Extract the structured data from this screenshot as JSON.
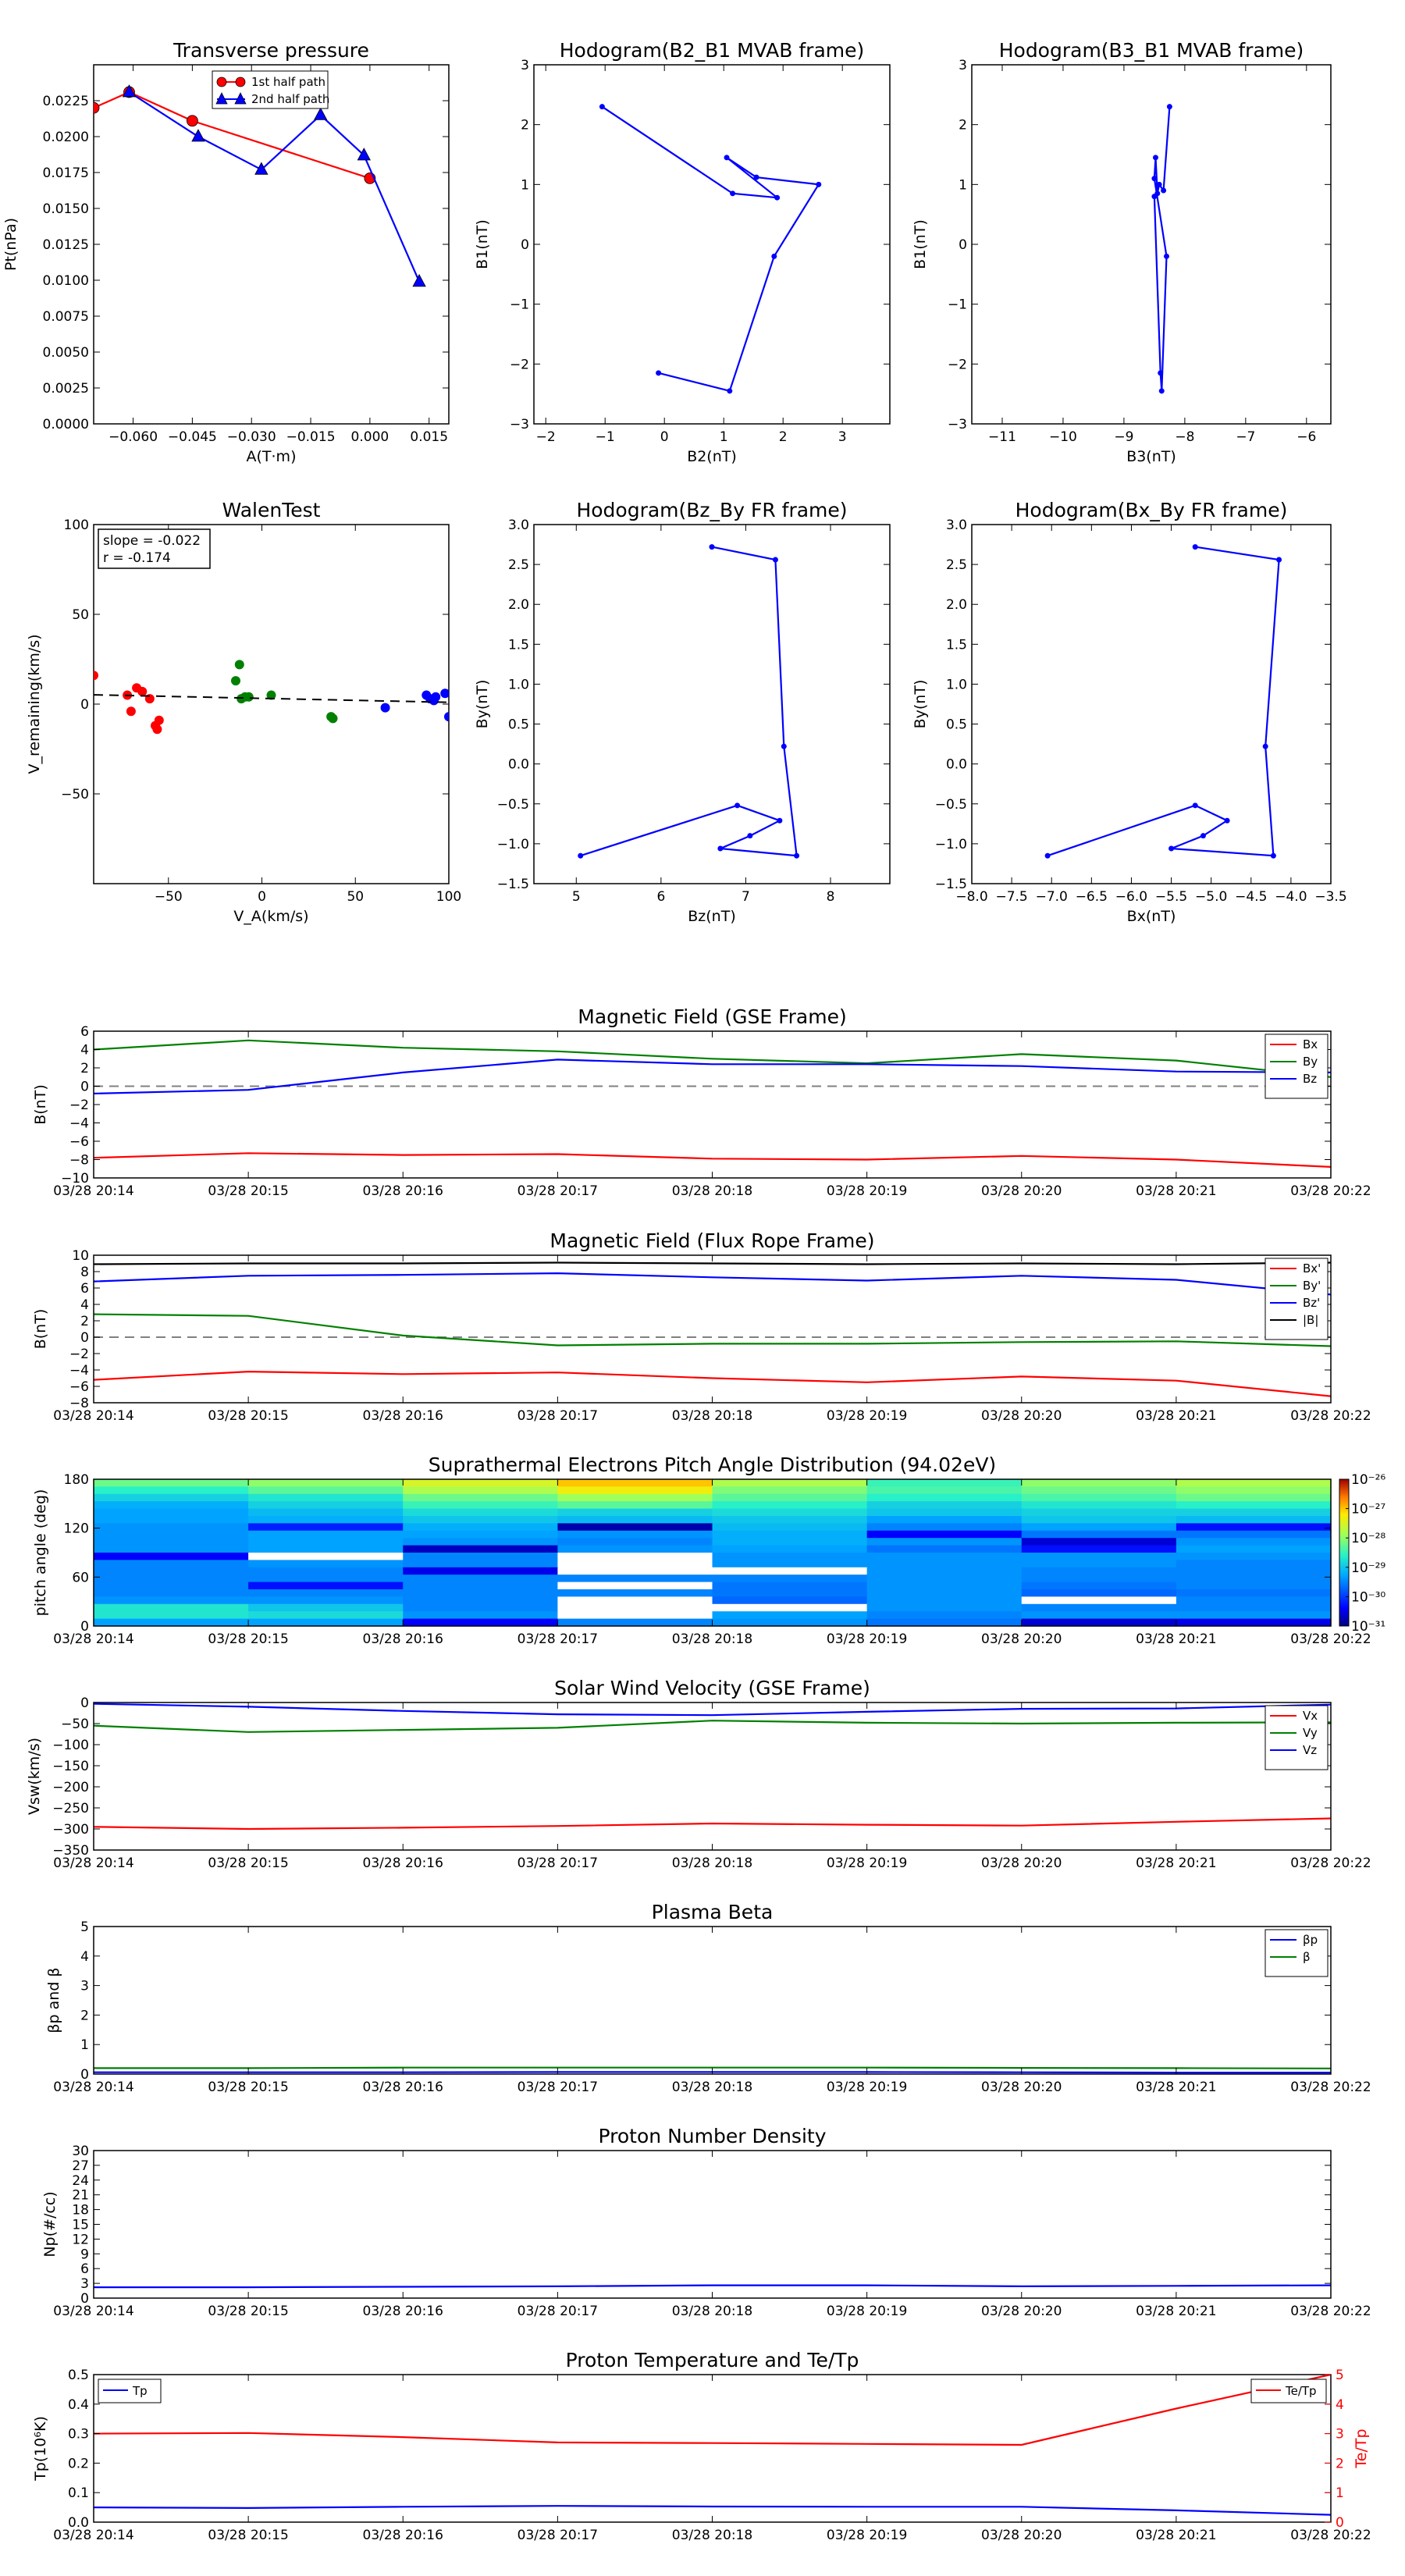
{
  "colors": {
    "red": "#ff0000",
    "green": "#008000",
    "blue": "#0000ff",
    "black": "#000000"
  },
  "time_ticks": [
    "03/28 20:14",
    "03/28 20:15",
    "03/28 20:16",
    "03/28 20:17",
    "03/28 20:18",
    "03/28 20:19",
    "03/28 20:20",
    "03/28 20:21",
    "03/28 20:22"
  ],
  "chart_data": [
    {
      "id": "transverse_pressure",
      "type": "line",
      "title": "Transverse pressure",
      "xlabel": "A(T·m)",
      "ylabel": "Pt(nPa)",
      "xlim": [
        -0.07,
        0.02
      ],
      "ylim": [
        0,
        0.025
      ],
      "xticks": [
        -0.06,
        -0.045,
        -0.03,
        -0.015,
        0.0,
        0.015
      ],
      "xtick_labels": [
        "−0.060",
        "−0.045",
        "−0.030",
        "−0.015",
        "0.000",
        "0.015"
      ],
      "yticks": [
        0,
        0.0025,
        0.005,
        0.0075,
        0.01,
        0.0125,
        0.015,
        0.0175,
        0.02,
        0.0225
      ],
      "ytick_labels": [
        "0.0000",
        "0.0025",
        "0.0050",
        "0.0075",
        "0.0100",
        "0.0125",
        "0.0150",
        "0.0175",
        "0.0200",
        "0.0225"
      ],
      "legend": [
        "1st half path",
        "2nd half path"
      ],
      "series": [
        {
          "name": "1st half path",
          "color": "#ff0000",
          "marker": "circle",
          "x": [
            -0.07,
            -0.061,
            -0.045,
            0.0
          ],
          "y": [
            0.022,
            0.0231,
            0.0211,
            0.0171
          ]
        },
        {
          "name": "2nd half path",
          "color": "#0000ff",
          "marker": "triangle",
          "x": [
            -0.061,
            -0.0435,
            -0.0275,
            -0.0125,
            -0.0015,
            0.0125
          ],
          "y": [
            0.0231,
            0.02,
            0.0177,
            0.0215,
            0.0187,
            0.0099
          ]
        }
      ]
    },
    {
      "id": "hodo_b2b1",
      "type": "line",
      "title": "Hodogram(B2_B1 MVAB frame)",
      "xlabel": "B2(nT)",
      "ylabel": "B1(nT)",
      "xlim": [
        -2.2,
        3.8
      ],
      "ylim": [
        -3,
        3
      ],
      "xticks": [
        -2,
        -1,
        0,
        1,
        2,
        3
      ],
      "xtick_labels": [
        "−2",
        "−1",
        "0",
        "1",
        "2",
        "3"
      ],
      "yticks": [
        -3,
        -2,
        -1,
        0,
        1,
        2,
        3
      ],
      "ytick_labels": [
        "−3",
        "−2",
        "−1",
        "0",
        "1",
        "2",
        "3"
      ],
      "series": [
        {
          "color": "#0000ff",
          "x": [
            -1.05,
            1.15,
            1.9,
            1.05,
            1.55,
            2.6,
            1.85,
            1.1,
            -0.1
          ],
          "y": [
            2.3,
            0.85,
            0.78,
            1.45,
            1.12,
            1.0,
            -0.2,
            -2.45,
            -2.15
          ]
        }
      ]
    },
    {
      "id": "hodo_b3b1",
      "type": "line",
      "title": "Hodogram(B3_B1 MVAB frame)",
      "xlabel": "B3(nT)",
      "ylabel": "B1(nT)",
      "xlim": [
        -11.5,
        -5.6
      ],
      "ylim": [
        -3,
        3
      ],
      "xticks": [
        -11,
        -10,
        -9,
        -8,
        -7,
        -6
      ],
      "xtick_labels": [
        "−11",
        "−10",
        "−9",
        "−8",
        "−7",
        "−6"
      ],
      "yticks": [
        -3,
        -2,
        -1,
        0,
        1,
        2,
        3
      ],
      "ytick_labels": [
        "−3",
        "−2",
        "−1",
        "0",
        "1",
        "2",
        "3"
      ],
      "series": [
        {
          "color": "#0000ff",
          "x": [
            -8.25,
            -8.35,
            -8.42,
            -8.45,
            -8.48,
            -8.5,
            -8.3,
            -8.38,
            -8.4,
            -8.5
          ],
          "y": [
            2.3,
            0.9,
            1.0,
            0.85,
            1.45,
            1.1,
            -0.2,
            -2.45,
            -2.15,
            0.8
          ]
        }
      ]
    },
    {
      "id": "walen",
      "type": "scatter",
      "title": "WalenTest",
      "xlabel": "V_A(km/s)",
      "ylabel": "V_remaining(km/s)",
      "xlim": [
        -90,
        100
      ],
      "ylim": [
        -100,
        100
      ],
      "xticks": [
        -50,
        0,
        50,
        100
      ],
      "xtick_labels": [
        "−50",
        "0",
        "50",
        "100"
      ],
      "yticks": [
        -50,
        0,
        50,
        100
      ],
      "ytick_labels": [
        "−50",
        "0",
        "50",
        "100"
      ],
      "annotation": {
        "line1": "slope = -0.022",
        "line2": "r = -0.174"
      },
      "fit": {
        "slope": -0.022,
        "intercept": 3.2
      },
      "series": [
        {
          "color": "#ff0000",
          "x": [
            -90,
            -72,
            -70,
            -67,
            -64,
            -60,
            -57,
            -56,
            -55
          ],
          "y": [
            16,
            5,
            -4,
            9,
            7,
            3,
            -12,
            -14,
            -9
          ]
        },
        {
          "color": "#008000",
          "x": [
            -14,
            -12,
            -11,
            -9,
            -7,
            5,
            37,
            38
          ],
          "y": [
            13,
            22,
            3,
            4,
            4,
            5,
            -7,
            -8
          ]
        },
        {
          "color": "#0000ff",
          "x": [
            66,
            88,
            90,
            92,
            93,
            98,
            100
          ],
          "y": [
            -2,
            5,
            3,
            2,
            4,
            6,
            -7
          ]
        }
      ]
    },
    {
      "id": "hodo_bzby",
      "type": "line",
      "title": "Hodogram(Bz_By FR frame)",
      "xlabel": "Bz(nT)",
      "ylabel": "By(nT)",
      "xlim": [
        4.5,
        8.7
      ],
      "ylim": [
        -1.5,
        3.0
      ],
      "xticks": [
        5,
        6,
        7,
        8
      ],
      "xtick_labels": [
        "5",
        "6",
        "7",
        "8"
      ],
      "yticks": [
        -1.5,
        -1.0,
        -0.5,
        0.0,
        0.5,
        1.0,
        1.5,
        2.0,
        2.5,
        3.0
      ],
      "ytick_labels": [
        "−1.5",
        "−1.0",
        "−0.5",
        "0.0",
        "0.5",
        "1.0",
        "1.5",
        "2.0",
        "2.5",
        "3.0"
      ],
      "series": [
        {
          "color": "#0000ff",
          "x": [
            6.6,
            7.35,
            7.45,
            7.6,
            6.7,
            7.05,
            7.4,
            6.9,
            5.05
          ],
          "y": [
            2.72,
            2.56,
            0.22,
            -1.15,
            -1.06,
            -0.9,
            -0.71,
            -0.52,
            -1.15
          ]
        }
      ]
    },
    {
      "id": "hodo_bxby",
      "type": "line",
      "title": "Hodogram(Bx_By FR frame)",
      "xlabel": "Bx(nT)",
      "ylabel": "By(nT)",
      "xlim": [
        -8.0,
        -3.5
      ],
      "ylim": [
        -1.5,
        3.0
      ],
      "xticks": [
        -8.0,
        -7.5,
        -7.0,
        -6.5,
        -6.0,
        -5.5,
        -5.0,
        -4.5,
        -4.0,
        -3.5
      ],
      "xtick_labels": [
        "−8.0",
        "−7.5",
        "−7.0",
        "−6.5",
        "−6.0",
        "−5.5",
        "−5.0",
        "−4.5",
        "−4.0",
        "−3.5"
      ],
      "yticks": [
        -1.5,
        -1.0,
        -0.5,
        0.0,
        0.5,
        1.0,
        1.5,
        2.0,
        2.5,
        3.0
      ],
      "ytick_labels": [
        "−1.5",
        "−1.0",
        "−0.5",
        "0.0",
        "0.5",
        "1.0",
        "1.5",
        "2.0",
        "2.5",
        "3.0"
      ],
      "series": [
        {
          "color": "#0000ff",
          "x": [
            -5.2,
            -4.15,
            -4.32,
            -4.22,
            -5.5,
            -5.1,
            -4.8,
            -5.2,
            -7.05
          ],
          "y": [
            2.72,
            2.56,
            0.22,
            -1.15,
            -1.06,
            -0.9,
            -0.71,
            -0.52,
            -1.15
          ]
        }
      ]
    },
    {
      "id": "mag_gse",
      "type": "line",
      "title": "Magnetic Field (GSE Frame)",
      "ylabel": "B(nT)",
      "ylim": [
        -10,
        6
      ],
      "yticks": [
        -10,
        -8,
        -6,
        -4,
        -2,
        0,
        2,
        4,
        6
      ],
      "ytick_labels": [
        "−10",
        "−8",
        "−6",
        "−4",
        "−2",
        "0",
        "2",
        "4",
        "6"
      ],
      "zero_line": true,
      "legend_pos": "right",
      "series": [
        {
          "name": "Bx",
          "color": "#ff0000",
          "y": [
            -7.8,
            -7.3,
            -7.5,
            -7.4,
            -7.9,
            -8.0,
            -7.6,
            -8.0,
            -8.8
          ]
        },
        {
          "name": "By",
          "color": "#008000",
          "y": [
            4.0,
            5.0,
            4.2,
            3.8,
            3.0,
            2.5,
            3.5,
            2.8,
            1.0
          ]
        },
        {
          "name": "Bz",
          "color": "#0000ff",
          "y": [
            -0.8,
            -0.4,
            1.5,
            2.9,
            2.4,
            2.4,
            2.2,
            1.6,
            1.5
          ]
        }
      ]
    },
    {
      "id": "mag_fr",
      "type": "line",
      "title": "Magnetic Field (Flux Rope Frame)",
      "ylabel": "B(nT)",
      "ylim": [
        -8,
        10
      ],
      "yticks": [
        -8,
        -6,
        -4,
        -2,
        0,
        2,
        4,
        6,
        8,
        10
      ],
      "ytick_labels": [
        "−8",
        "−6",
        "−4",
        "−2",
        "0",
        "2",
        "4",
        "6",
        "8",
        "10"
      ],
      "zero_line": true,
      "legend_pos": "right",
      "series": [
        {
          "name": "Bx'",
          "color": "#ff0000",
          "y": [
            -5.2,
            -4.2,
            -4.5,
            -4.3,
            -5.0,
            -5.5,
            -4.8,
            -5.3,
            -7.2
          ]
        },
        {
          "name": "By'",
          "color": "#008000",
          "y": [
            2.8,
            2.6,
            0.2,
            -1.0,
            -0.8,
            -0.8,
            -0.6,
            -0.5,
            -1.1
          ]
        },
        {
          "name": "Bz'",
          "color": "#0000ff",
          "y": [
            6.8,
            7.5,
            7.6,
            7.8,
            7.3,
            6.9,
            7.5,
            7.0,
            5.2
          ]
        },
        {
          "name": "|B|",
          "color": "#000000",
          "y": [
            8.9,
            9.0,
            9.0,
            9.1,
            9.0,
            8.9,
            9.0,
            8.9,
            9.1
          ]
        }
      ]
    },
    {
      "id": "pad",
      "type": "heatmap",
      "title": "Suprathermal Electrons Pitch Angle Distribution (94.02eV)",
      "ylabel": "pitch angle (deg)",
      "ylim": [
        0,
        180
      ],
      "yticks": [
        0,
        60,
        120,
        180
      ],
      "ytick_labels": [
        "0",
        "60",
        "120",
        "180"
      ],
      "colorbar_labels": [
        "10⁻²⁶",
        "10⁻²⁷",
        "10⁻²⁸",
        "10⁻²⁹",
        "10⁻³⁰",
        "10⁻³¹"
      ],
      "colorbar_range": [
        -31,
        -26
      ],
      "rows": 20,
      "cols": 8,
      "values": [
        [
          -28.2,
          -28.0,
          -27.5,
          -27.0,
          -27.8,
          -28.5,
          -28.0,
          -27.8
        ],
        [
          -28.6,
          -28.3,
          -27.8,
          -27.3,
          -28.1,
          -28.4,
          -28.2,
          -28.0
        ],
        [
          -28.9,
          -28.7,
          -28.2,
          -27.9,
          -28.3,
          -28.6,
          -28.4,
          -28.2
        ],
        [
          -29.2,
          -28.9,
          -28.5,
          -28.3,
          -28.6,
          -28.9,
          -28.7,
          -28.6
        ],
        [
          -29.3,
          -29.1,
          -28.8,
          -28.9,
          -28.8,
          -29.0,
          -28.9,
          -28.9
        ],
        [
          -29.3,
          -29.2,
          -29.0,
          -29.1,
          -29.0,
          -29.3,
          -29.0,
          -29.1
        ],
        [
          -29.4,
          -30.2,
          -29.2,
          -30.8,
          -29.1,
          -29.5,
          -29.3,
          -30.3
        ],
        [
          -29.4,
          -29.3,
          -29.3,
          -29.4,
          -29.2,
          -30.4,
          -29.6,
          -29.6
        ],
        [
          -29.4,
          -29.3,
          -29.4,
          -29.5,
          -29.2,
          -29.4,
          -30.6,
          -29.4
        ],
        [
          -29.4,
          -29.3,
          -30.7,
          -29.4,
          -29.3,
          -29.6,
          -30.3,
          -29.3
        ],
        [
          -30.4,
          -31.5,
          -29.5,
          -31.5,
          -29.4,
          -29.4,
          -29.4,
          -29.4
        ],
        [
          -29.5,
          -29.4,
          -29.5,
          -31.5,
          -29.4,
          -29.4,
          -29.4,
          -29.5
        ],
        [
          -29.5,
          -29.5,
          -30.5,
          -31.5,
          -31.5,
          -29.4,
          -29.5,
          -29.5
        ],
        [
          -29.5,
          -29.5,
          -29.5,
          -29.5,
          -29.5,
          -29.4,
          -29.5,
          -29.5
        ],
        [
          -29.5,
          -30.3,
          -29.5,
          -31.5,
          -29.6,
          -29.4,
          -29.6,
          -29.5
        ],
        [
          -29.5,
          -29.5,
          -29.5,
          -29.5,
          -29.6,
          -29.4,
          -29.7,
          -29.6
        ],
        [
          -29.4,
          -29.4,
          -29.5,
          -31.5,
          -29.7,
          -29.4,
          -31.5,
          -29.5
        ],
        [
          -28.7,
          -29.0,
          -29.5,
          -31.5,
          -31.5,
          -29.4,
          -29.5,
          -29.5
        ],
        [
          -28.7,
          -28.8,
          -29.4,
          -31.5,
          -29.3,
          -29.5,
          -29.4,
          -29.4
        ],
        [
          -29.3,
          -29.3,
          -30.4,
          -29.5,
          -29.4,
          -29.6,
          -30.6,
          -30.5
        ]
      ]
    },
    {
      "id": "vsw",
      "type": "line",
      "title": "Solar Wind Velocity (GSE Frame)",
      "ylabel": "Vsw(km/s)",
      "ylim": [
        -350,
        0
      ],
      "yticks": [
        -350,
        -300,
        -250,
        -200,
        -150,
        -100,
        -50,
        0
      ],
      "ytick_labels": [
        "−350",
        "−300",
        "−250",
        "−200",
        "−150",
        "−100",
        "−50",
        "0"
      ],
      "legend_pos": "right",
      "series": [
        {
          "name": "Vx",
          "color": "#ff0000",
          "y": [
            -295,
            -300,
            -297,
            -293,
            -287,
            -290,
            -292,
            -283,
            -275
          ]
        },
        {
          "name": "Vy",
          "color": "#008000",
          "y": [
            -55,
            -70,
            -65,
            -60,
            -43,
            -48,
            -50,
            -48,
            -47
          ]
        },
        {
          "name": "Vz",
          "color": "#0000ff",
          "y": [
            -3,
            -10,
            -20,
            -28,
            -30,
            -22,
            -15,
            -14,
            -5
          ]
        }
      ]
    },
    {
      "id": "beta",
      "type": "line",
      "title": "Plasma Beta",
      "ylabel": "βp and β",
      "ylim": [
        0,
        5
      ],
      "yticks": [
        0,
        1,
        2,
        3,
        4,
        5
      ],
      "ytick_labels": [
        "0",
        "1",
        "2",
        "3",
        "4",
        "5"
      ],
      "legend_pos": "right",
      "series": [
        {
          "name": "βp",
          "color": "#0000ff",
          "y": [
            0.06,
            0.06,
            0.06,
            0.07,
            0.07,
            0.07,
            0.06,
            0.05,
            0.05
          ]
        },
        {
          "name": "β",
          "color": "#008000",
          "y": [
            0.2,
            0.2,
            0.22,
            0.22,
            0.22,
            0.22,
            0.21,
            0.2,
            0.19
          ]
        }
      ]
    },
    {
      "id": "density",
      "type": "line",
      "title": "Proton Number Density",
      "ylabel": "Np(#/cc)",
      "ylim": [
        0,
        30
      ],
      "yticks": [
        0,
        3,
        6,
        9,
        12,
        15,
        18,
        21,
        24,
        27,
        30
      ],
      "ytick_labels": [
        "0",
        "3",
        "6",
        "9",
        "12",
        "15",
        "18",
        "21",
        "24",
        "27",
        "30"
      ],
      "series": [
        {
          "color": "#0000ff",
          "y": [
            2.2,
            2.2,
            2.3,
            2.4,
            2.6,
            2.6,
            2.4,
            2.5,
            2.6
          ]
        }
      ]
    },
    {
      "id": "temp",
      "type": "line",
      "title": "Proton Temperature and Te/Tp",
      "ylabel": "Tp(10⁶K)",
      "ylim": [
        0,
        0.5
      ],
      "yticks": [
        0,
        0.1,
        0.2,
        0.3,
        0.4,
        0.5
      ],
      "ytick_labels": [
        "0.0",
        "0.1",
        "0.2",
        "0.3",
        "0.4",
        "0.5"
      ],
      "y2label": "Te/Tp",
      "y2lim": [
        0,
        5
      ],
      "y2ticks": [
        0,
        1,
        2,
        3,
        4,
        5
      ],
      "y2tick_labels": [
        "0",
        "1",
        "2",
        "3",
        "4",
        "5"
      ],
      "series": [
        {
          "name": "Tp",
          "color": "#0000ff",
          "axis": "left",
          "y": [
            0.05,
            0.048,
            0.052,
            0.055,
            0.053,
            0.052,
            0.052,
            0.04,
            0.025
          ]
        },
        {
          "name": "Te/Tp",
          "color": "#ff0000",
          "axis": "right",
          "y": [
            3.0,
            3.02,
            2.88,
            2.7,
            2.68,
            2.65,
            2.62,
            3.85,
            5.0
          ]
        }
      ]
    }
  ]
}
